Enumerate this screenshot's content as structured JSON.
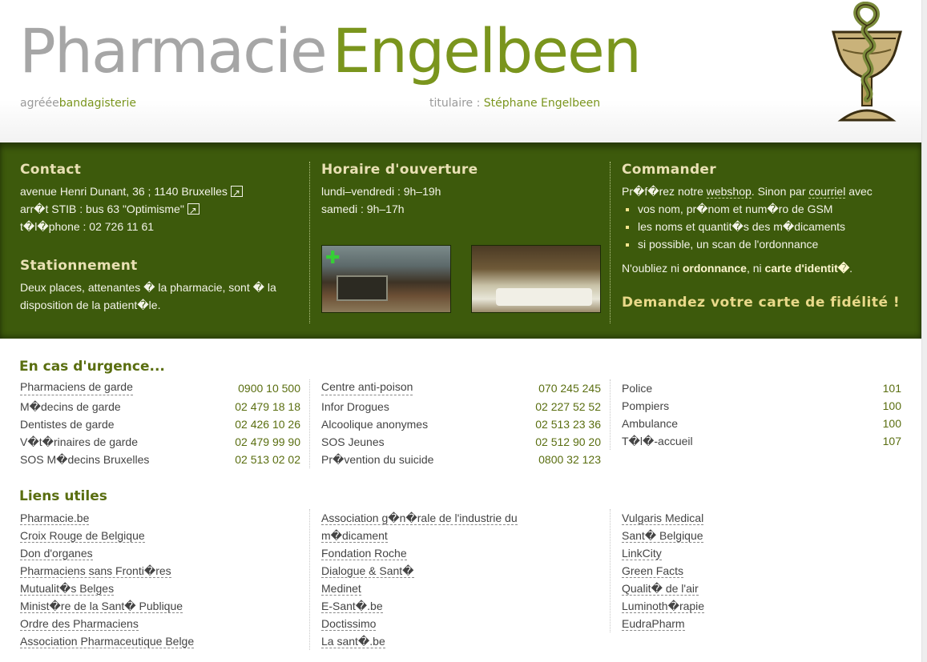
{
  "header": {
    "brand_part1": "Pharmacie",
    "brand_part2": "Engelbeen",
    "tagline_prefix": "agréée",
    "tagline_highlight": "bandagisterie",
    "owner_prefix": "titulaire :",
    "owner_name": "Stéphane Engelbeen",
    "logo_icon": "pharmacy-bowl-of-hygieia-icon"
  },
  "contact": {
    "title": "Contact",
    "address": "avenue Henri Dunant, 36 ; 1140 Bruxelles",
    "stop": "arr�t STIB : bus 63 \"Optimisme\"",
    "phone": "t�l�phone : 02 726 11 61"
  },
  "parking": {
    "title": "Stationnement",
    "text": "Deux places, attenantes � la pharmacie, sont � la disposition de la patient�le."
  },
  "hours": {
    "title": "Horaire d'ouverture",
    "weekdays": "lundi–vendredi : 9h–19h",
    "saturday": "samedi : 9h–17h"
  },
  "order": {
    "title": "Commander",
    "intro_1": "Pr�f�rez notre",
    "webshop": "webshop",
    "intro_2": ". Sinon par",
    "email": "courriel",
    "intro_3": "avec",
    "items": [
      "vos nom, pr�nom et num�ro de GSM",
      "les noms et quantit�s des m�dicaments",
      "si possible, un scan de l'ordonnance"
    ],
    "note_1": "N'oubliez ni",
    "note_b1": "ordonnance",
    "note_2": ", ni",
    "note_b2": "carte d'identit�",
    "note_3": ".",
    "loyalty": "Demandez votre carte de fidélité !"
  },
  "urgence": {
    "title": "En cas d'urgence...",
    "col1": [
      {
        "label": "Pharmaciens de garde",
        "number": "0900 10 500",
        "link": true
      },
      {
        "label": "M�decins de garde",
        "number": "02 479 18 18",
        "link": false
      },
      {
        "label": "Dentistes de garde",
        "number": "02 426 10 26",
        "link": false
      },
      {
        "label": "V�t�rinaires de garde",
        "number": "02 479 99 90",
        "link": false
      },
      {
        "label": "SOS M�decins Bruxelles",
        "number": "02 513 02 02",
        "link": false
      }
    ],
    "col2": [
      {
        "label": "Centre anti-poison",
        "number": "070 245 245",
        "link": true
      },
      {
        "label": "Infor Drogues",
        "number": "02 227 52 52",
        "link": false
      },
      {
        "label": "Alcoolique anonymes",
        "number": "02 513 23 36",
        "link": false
      },
      {
        "label": "SOS Jeunes",
        "number": "02 512 90 20",
        "link": false
      },
      {
        "label": "Pr�vention du suicide",
        "number": "0800 32 123",
        "link": false
      }
    ],
    "col3": [
      {
        "label": "Police",
        "number": "101",
        "link": false
      },
      {
        "label": "Pompiers",
        "number": "100",
        "link": false
      },
      {
        "label": "Ambulance",
        "number": "100",
        "link": false
      },
      {
        "label": "T�l�-accueil",
        "number": "107",
        "link": false
      }
    ]
  },
  "links": {
    "title": "Liens utiles",
    "col1": [
      "Pharmacie.be",
      "Croix Rouge de Belgique",
      "Don d'organes",
      "Pharmaciens sans Fronti�res",
      "Mutualit�s Belges",
      "Minist�re de la Sant� Publique",
      "Ordre des Pharmaciens",
      "Association Pharmaceutique Belge"
    ],
    "col2": [
      "Association g�n�rale de l'industrie du",
      "m�dicament",
      "Fondation Roche",
      "Dialogue & Sant�",
      "Medinet",
      "E-Sant�.be",
      "Doctissimo",
      "La sant�.be"
    ],
    "col3": [
      "Vulgaris Medical",
      "Sant� Belgique",
      "LinkCity",
      "Green Facts",
      "Qualit� de l'air",
      "Luminoth�rapie",
      "EudraPharm"
    ]
  },
  "colors": {
    "accent_green": "#7a951d",
    "band_green": "#3d5a0c",
    "heading_cream": "#e9e0b4"
  }
}
